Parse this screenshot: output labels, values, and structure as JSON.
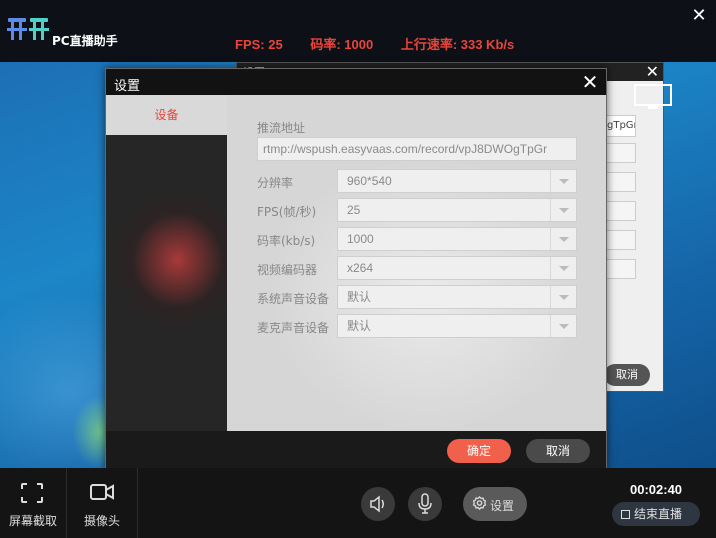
{
  "app": {
    "title": "PC直播助手"
  },
  "stats": {
    "fps": "FPS: 25",
    "bitrate": "码率: 1000",
    "upload": "上行速率: 333 Kb/s"
  },
  "back_dialog": {
    "title": "设置",
    "url_fragment": "gTpGr",
    "cancel_label": "取消"
  },
  "dialog": {
    "title": "设置",
    "tab_label": "设备",
    "url_label": "推流地址",
    "url_value": "rtmp://wspush.easyvaas.com/record/vpJ8DWOgTpGr",
    "fields": [
      {
        "label": "分辨率",
        "value": "960*540"
      },
      {
        "label": "FPS(帧/秒)",
        "value": "25"
      },
      {
        "label": "码率(kb/s)",
        "value": "1000"
      },
      {
        "label": "视频编码器",
        "value": "x264"
      },
      {
        "label": "系统声音设备",
        "value": "默认"
      },
      {
        "label": "麦克声音设备",
        "value": "默认"
      }
    ],
    "ok_label": "确定",
    "cancel_label": "取消"
  },
  "bottom": {
    "screenshot_label": "屏幕截取",
    "camera_label": "摄像头",
    "settings_label": "设置",
    "timer": "00:02:40",
    "end_live_label": "结束直播"
  },
  "colors": {
    "accent": "#f0604a",
    "stats_red": "#e8453c"
  }
}
